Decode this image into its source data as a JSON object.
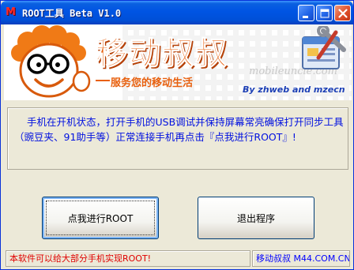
{
  "window": {
    "title": "ROOT工具 Beta V1.0",
    "app_icon": "M"
  },
  "banner": {
    "brand": "移动叔叔",
    "slogan": "服务您的移动生活",
    "watermark": "mobileuncle.com",
    "byline": "By zhweb and mzecn",
    "accent": "#e8600e"
  },
  "message": {
    "text": "手机在开机状态，打开手机的USB调试并保持屏幕常亮确保打开同步工具（豌豆夹、91助手等）正常连接手机再点击『点我进行ROOT』!",
    "color": "#0010e0"
  },
  "buttons": {
    "root_label": "点我进行ROOT",
    "exit_label": "退出程序"
  },
  "status": {
    "left_text": "本软件可以给大部分手机实现ROOT!",
    "right_text": "移动叔叔  M44.COM.CN",
    "left_color": "#e00000",
    "right_color": "#0000ff"
  }
}
